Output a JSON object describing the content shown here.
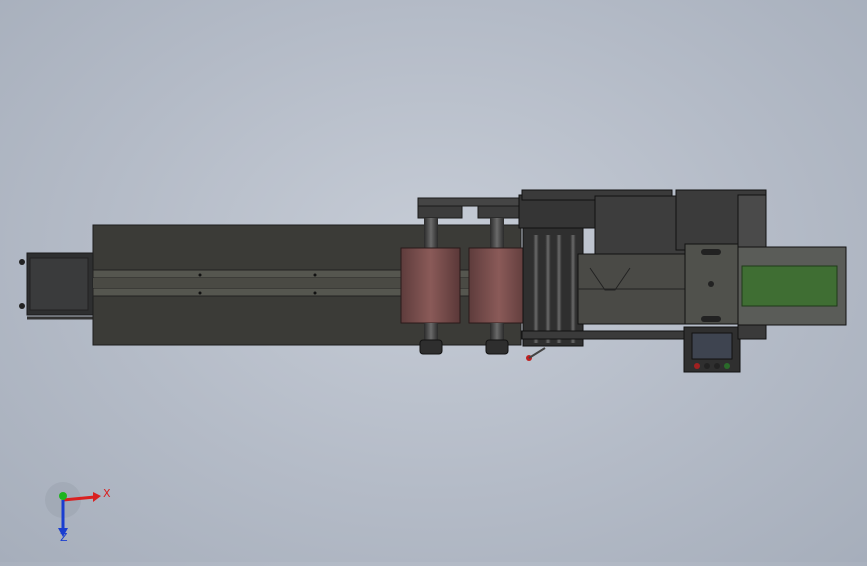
{
  "viewport": {
    "background_top": "#c6ccd6",
    "background_bottom": "#a6aebb"
  },
  "model": {
    "body_color": "#3a3a36",
    "dark_color": "#2b2b2a",
    "roller_color": "#7a5050",
    "screen_color": "#3e4450",
    "conveyor_color": "#3f6e33"
  },
  "triad": {
    "x_label": "X",
    "z_label": "Z",
    "x_color": "#d92020",
    "y_color": "#1eb41e",
    "z_color": "#1a3ed0"
  }
}
